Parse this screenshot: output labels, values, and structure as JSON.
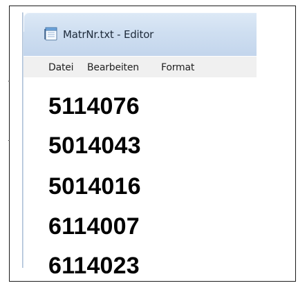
{
  "window": {
    "title": "MatrNr.txt - Editor",
    "icon": "notepad-icon"
  },
  "menu": {
    "items": [
      {
        "label": "Datei"
      },
      {
        "label": "Bearbeiten"
      },
      {
        "label": "Format"
      }
    ]
  },
  "document": {
    "lines": [
      "5114076",
      "5014043",
      "5014016",
      "6114007",
      "6114023"
    ]
  }
}
